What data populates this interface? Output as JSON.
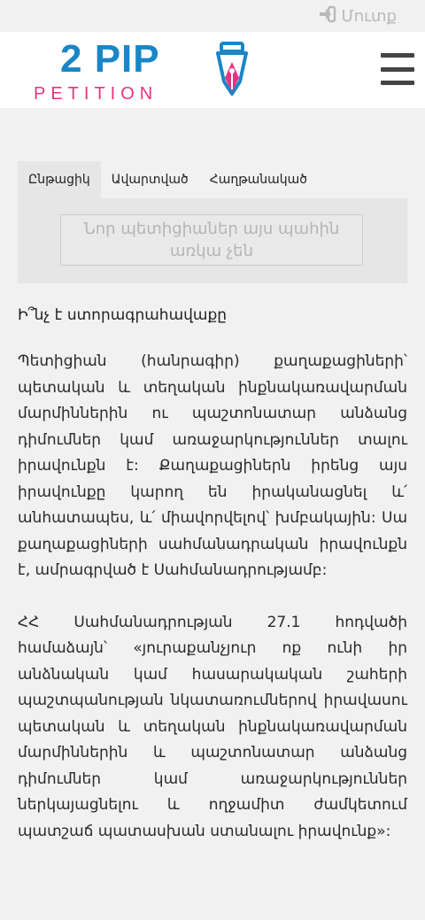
{
  "topbar": {
    "login_label": "Մուտք",
    "login_icon": "sign-in-icon"
  },
  "logo": {
    "line1": "2 PIP",
    "line2": "PETITION",
    "colors": {
      "blue": "#1a86c6",
      "pink": "#e7337f"
    }
  },
  "header": {
    "menu_icon": "hamburger-icon"
  },
  "tabs": [
    {
      "label": "Ընթացիկ",
      "active": true
    },
    {
      "label": "Ավարտված",
      "active": false
    },
    {
      "label": "Հաղթանակած",
      "active": false
    }
  ],
  "panel": {
    "notice": "Նոր պետիցիաներ այս պահին առկա չեն"
  },
  "content": {
    "title": "Ի՞նչ է ստորագրահավաքը",
    "paragraph1": "Պետիցիան (հանրագիր) քաղաքացիների՝ պետական և տեղական ինքնակառավարման մարմիններին ու պաշտոնատար անձանց դիմումներ կամ առաջարկություններ տալու իրավունքն է: Քաղաքացիներն իրենց այս իրավունքը կարող են իրականացնել և՛ անհատապես, և՛ միավորվելով՝ խմբակային: Սա քաղաքացիների սահմանադրական իրավունքն է, ամրագրված է Սահմանադրությամբ:",
    "paragraph2": "ՀՀ Սահմանադրության 27.1 հոդվածի համաձայն՝ «յուրաքանչյուր ոք ունի իր անձնական կամ հասարակական շահերի պաշտպանության նկատառումներով իրավասու պետական և տեղական ինքնակառավարման մարմիններին և պաշտոնատար անձանց դիմումներ կամ առաջարկություններ ներկայացնելու և ողջամիտ ժամկետում պատշաճ պատասխան ստանալու իրավունք»:"
  }
}
